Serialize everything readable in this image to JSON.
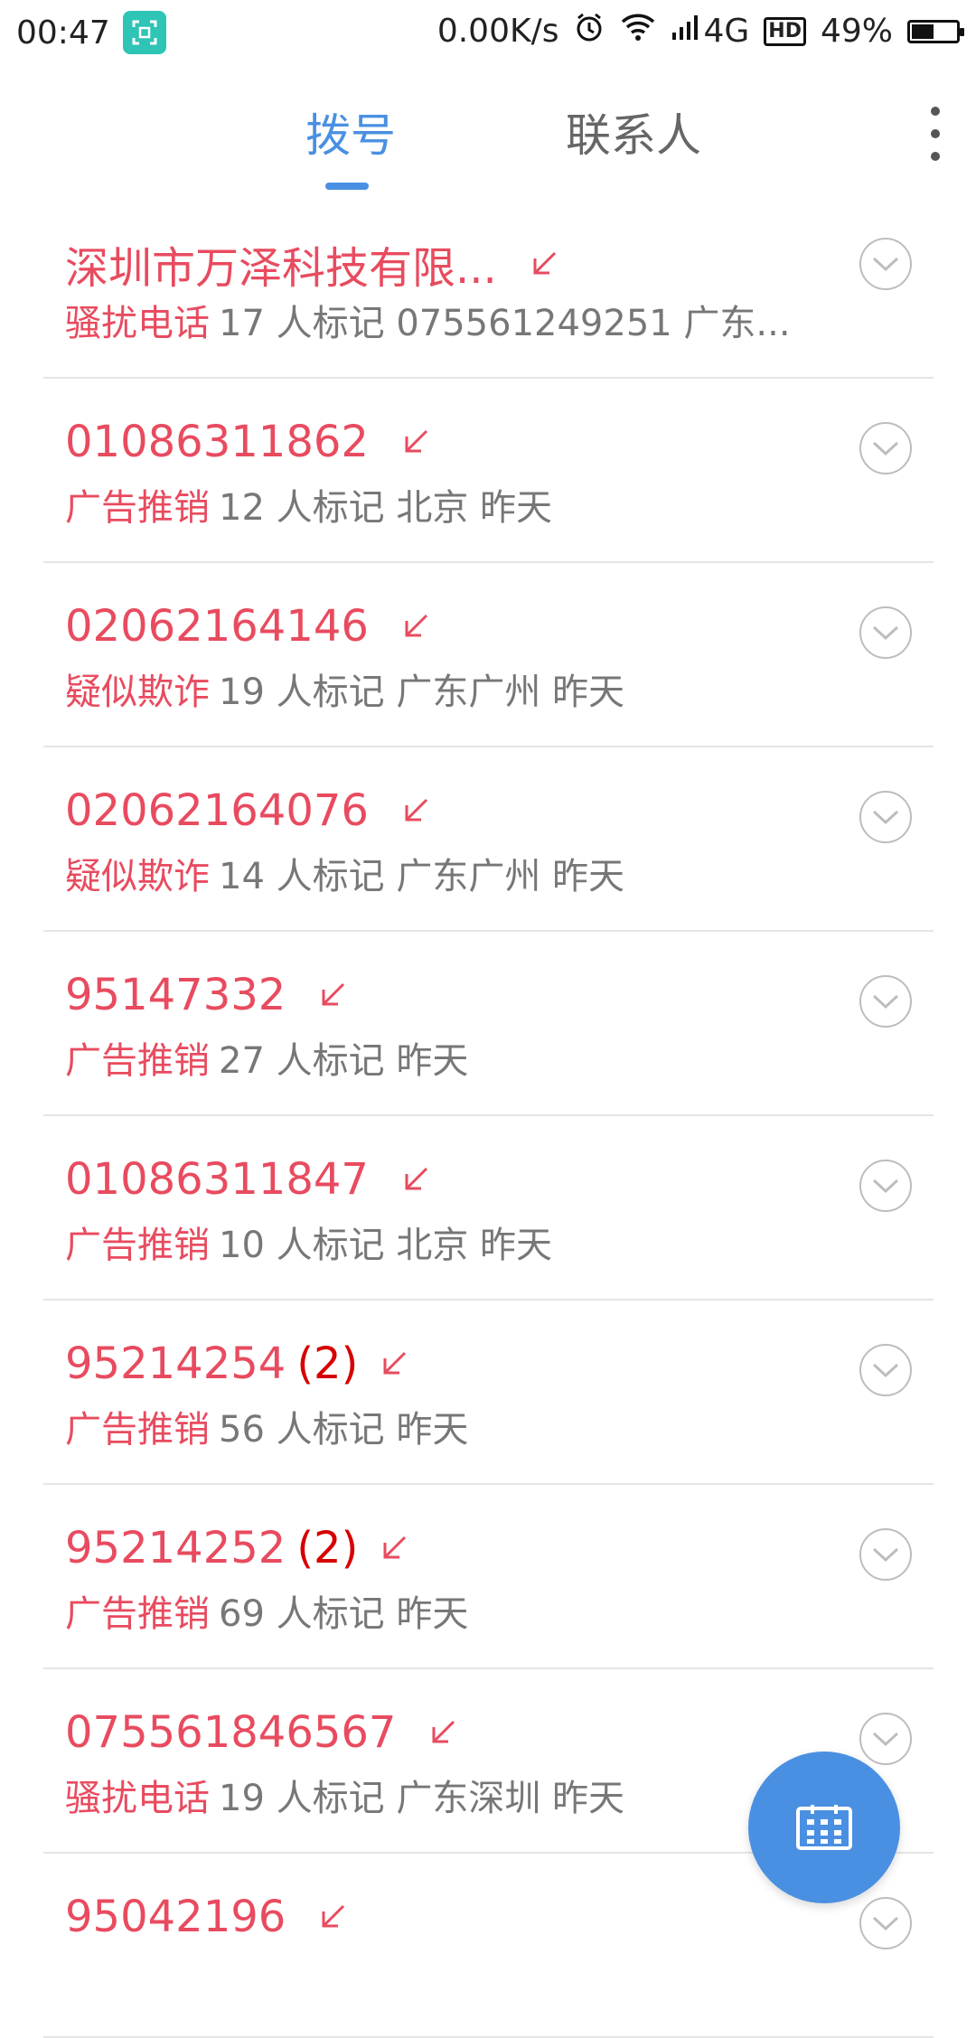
{
  "status_bar": {
    "time": "00:47",
    "net_speed": "0.00K/s",
    "network": "4G",
    "hd": "HD",
    "battery": "49%"
  },
  "tabs": [
    {
      "label": "拨号",
      "active": true
    },
    {
      "label": "联系人",
      "active": false
    }
  ],
  "calls": [
    {
      "name": "深圳市万泽科技有限...",
      "count": "",
      "tag": "骚扰电话",
      "info": "17 人标记 075561249251 广东..."
    },
    {
      "name": "01086311862",
      "count": "",
      "tag": "广告推销",
      "info": "12 人标记 北京 昨天"
    },
    {
      "name": "02062164146",
      "count": "",
      "tag": "疑似欺诈",
      "info": "19 人标记 广东广州 昨天"
    },
    {
      "name": "02062164076",
      "count": "",
      "tag": "疑似欺诈",
      "info": "14 人标记 广东广州 昨天"
    },
    {
      "name": "95147332",
      "count": "",
      "tag": "广告推销",
      "info": "27 人标记 昨天"
    },
    {
      "name": "01086311847",
      "count": "",
      "tag": "广告推销",
      "info": "10 人标记 北京 昨天"
    },
    {
      "name": "95214254",
      "count": "(2)",
      "tag": "广告推销",
      "info": "56 人标记 昨天"
    },
    {
      "name": "95214252",
      "count": "(2)",
      "tag": "广告推销",
      "info": "69 人标记 昨天"
    },
    {
      "name": "075561846567",
      "count": "",
      "tag": "骚扰电话",
      "info": "19 人标记 广东深圳 昨天"
    },
    {
      "name": "95042196",
      "count": "",
      "tag": "",
      "info": ""
    }
  ],
  "colors": {
    "accent": "#4a90e2",
    "missed": "#e84b5f",
    "count": "#d60000"
  },
  "icons": {
    "missed_call": "missed-call-arrow-icon",
    "expand": "chevron-down-circle-icon",
    "fab": "dialpad-icon",
    "more": "more-vertical-icon"
  },
  "battery_level": 0.49
}
